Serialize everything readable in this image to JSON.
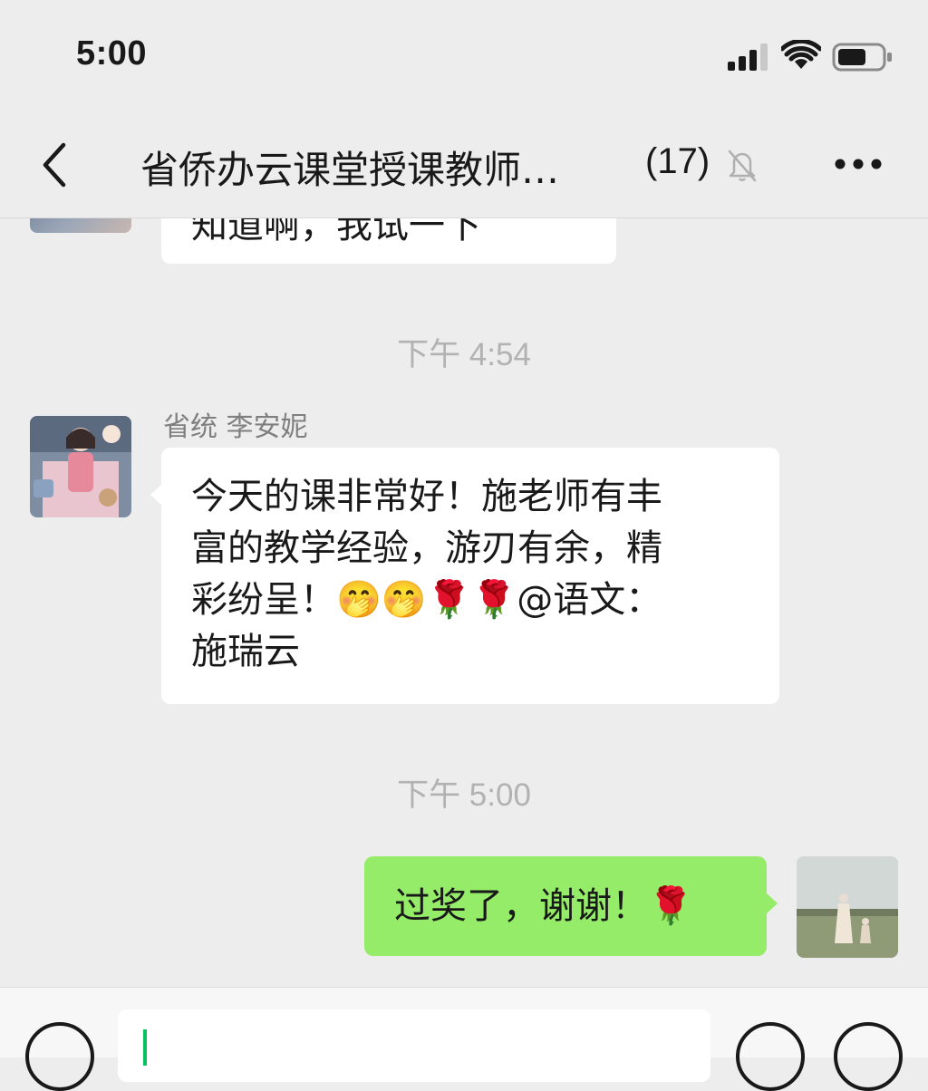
{
  "status_bar": {
    "time": "5:00",
    "icons": [
      "cellular-signal-icon",
      "wifi-icon",
      "battery-icon"
    ]
  },
  "nav": {
    "back_icon": "chevron-left-icon",
    "title": "省侨办云课堂授课教师…",
    "member_count": "(17)",
    "mute_icon": "bell-slash-icon",
    "more_icon": "more-dots-icon"
  },
  "messages": {
    "prev_partial_text": "知道啊，我试一下",
    "timestamp_1": "下午 4:54",
    "msg1_sender": "省统 李安妮",
    "msg1_line1": "今天的课非常好！施老师有丰",
    "msg1_line2": "富的教学经验，游刃有余，精",
    "msg1_line3": "彩纷呈！🤭🤭🌹🌹@语文：",
    "msg1_line4": "施瑞云",
    "timestamp_2": "下午 5:00",
    "msg2_text": "过奖了，谢谢！🌹"
  },
  "input_bar": {
    "voice_icon": "voice-icon",
    "emoji_icon": "emoji-face-icon",
    "plus_icon": "plus-icon"
  },
  "colors": {
    "background": "#ededed",
    "own_bubble": "#95ec69",
    "other_bubble": "#ffffff",
    "timestamp": "#b2b2b2",
    "caret": "#07c160"
  }
}
